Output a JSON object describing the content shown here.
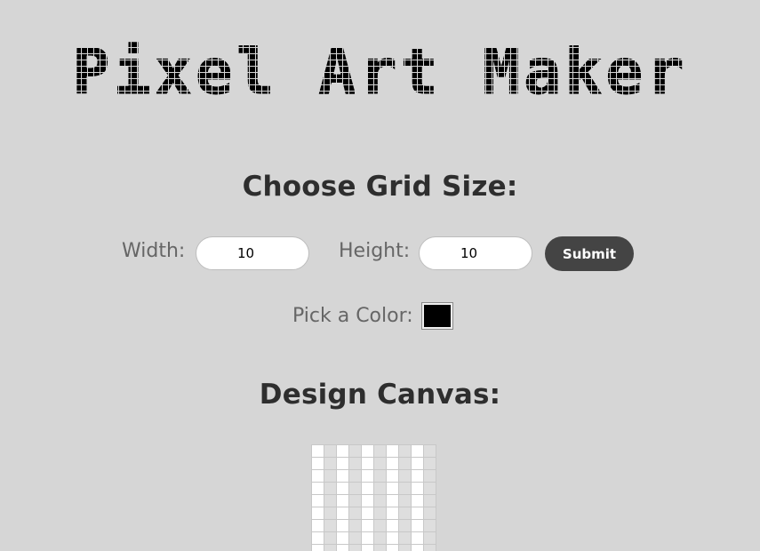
{
  "header": {
    "logo_text": "Pixel Art Maker"
  },
  "controls": {
    "heading": "Choose Grid Size:",
    "width_label": "Width:",
    "width_value": "10",
    "height_label": "Height:",
    "height_value": "10",
    "submit_label": "Submit",
    "color_label": "Pick a Color:",
    "color_value": "#000000"
  },
  "canvas": {
    "heading": "Design Canvas:",
    "rows": 10,
    "cols": 10
  },
  "colors": {
    "background": "#d6d6d6",
    "button": "#444444"
  }
}
